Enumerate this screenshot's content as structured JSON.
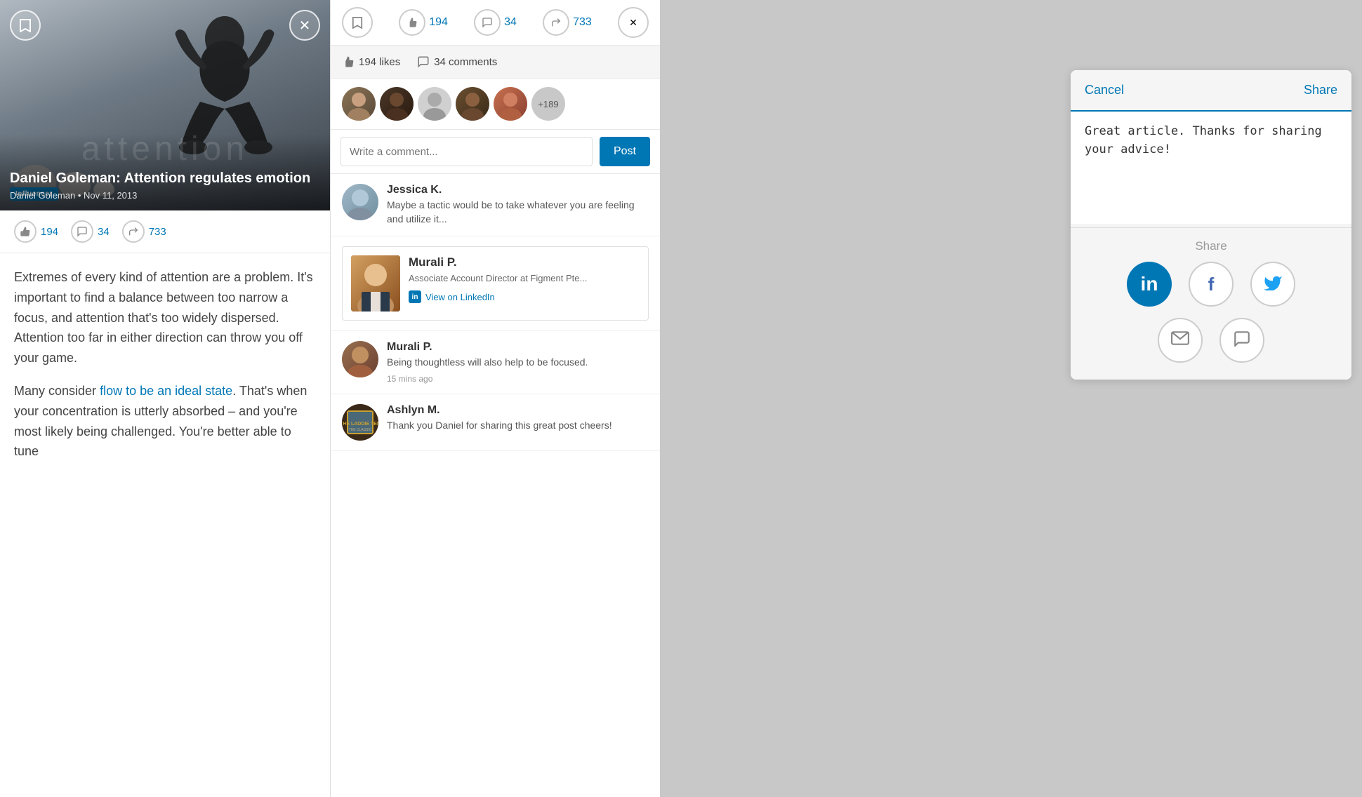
{
  "app": {
    "name": "Influencer"
  },
  "article_panel": {
    "bookmark_label": "🔖",
    "close_label": "✕",
    "influencer_badge": "influencer",
    "hero_attention_text": "attention",
    "title": "Daniel Goleman: Attention regulates emotion",
    "author": "Daniel Goleman",
    "date": "Nov 11, 2013",
    "stats": {
      "likes": "194",
      "comments": "34",
      "shares": "733"
    },
    "body_paragraph1": "Extremes of every kind of attention are a problem. It's important to find a balance between too narrow a focus, and attention that's too widely dispersed. Attention too far in either direction can throw you off your game.",
    "body_paragraph2_prefix": "Many consider ",
    "body_link": "flow to be an ideal state",
    "body_paragraph2_suffix": ". That's when your concentration is utterly absorbed – and you're most likely being challenged. You're better able to tune"
  },
  "comments_panel": {
    "toolbar": {
      "bookmark_label": "🔖",
      "like_count": "194",
      "comment_count": "34",
      "share_count": "733",
      "close_label": "✕"
    },
    "header": {
      "likes_label": "194 likes",
      "comments_label": "34 comments"
    },
    "more_likers": "+189",
    "comment_input_placeholder": "Write a comment...",
    "post_button": "Post",
    "comments": [
      {
        "id": "jessica",
        "author": "Jessica K.",
        "text": "Maybe a tactic would be to take whatever you are feeling and utilize it...",
        "time": ""
      },
      {
        "id": "murali-profile",
        "type": "profile-card",
        "card_name": "Murali P.",
        "card_title": "Associate Account Director at Figment Pte...",
        "card_linkedin": "View on LinkedIn"
      },
      {
        "id": "murali",
        "author": "Murali P.",
        "text": "Being thoughtless will also help to be focused.",
        "time": "15 mins ago"
      },
      {
        "id": "ashlyn",
        "author": "Ashlyn M.",
        "text": "Thank you Daniel for sharing this great post cheers!",
        "time": ""
      }
    ]
  },
  "share_panel": {
    "cancel_label": "Cancel",
    "share_label": "Share",
    "message_text": "Great article. Thanks for sharing your advice!",
    "section_label": "Share",
    "social_icons": {
      "linkedin": "in",
      "facebook": "f",
      "twitter": "🐦",
      "email": "✉",
      "message": "💬"
    }
  }
}
